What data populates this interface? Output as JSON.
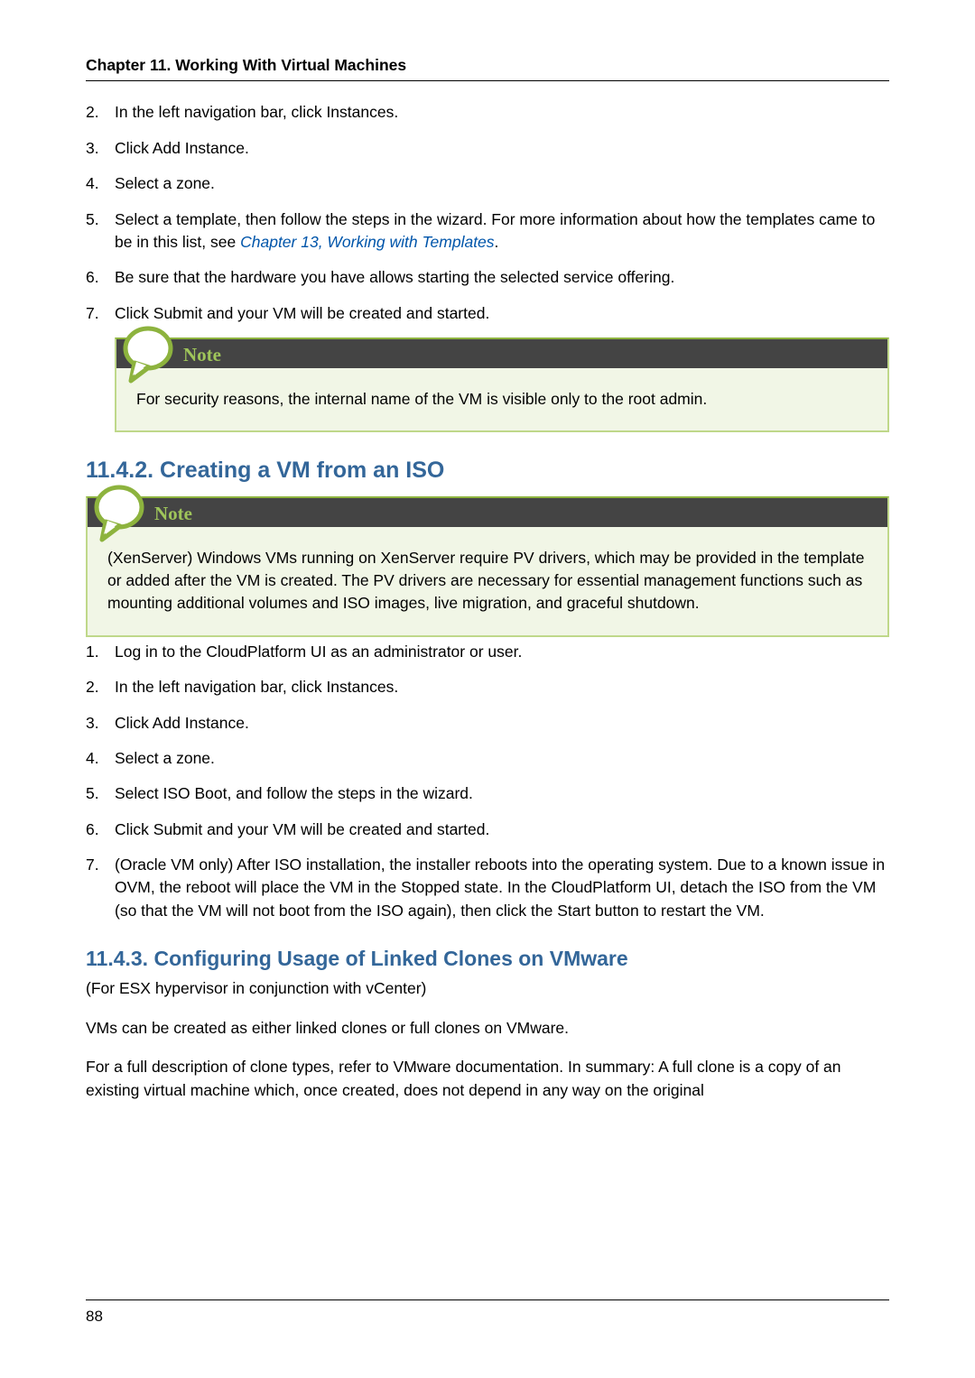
{
  "chapter_header": "Chapter 11. Working With Virtual Machines",
  "list1": {
    "n2": "2.",
    "t2": "In the left navigation bar, click Instances.",
    "n3": "3.",
    "t3": "Click Add Instance.",
    "n4": "4.",
    "t4": "Select a zone.",
    "n5": "5.",
    "t5a": "Select a template, then follow the steps in the wizard. For more information about how the templates came to be in this list, see ",
    "t5link": "Chapter 13, Working with Templates",
    "t5b": ".",
    "n6": "6.",
    "t6": "Be sure that the hardware you have allows starting the selected service offering.",
    "n7": "7.",
    "t7": "Click Submit and your VM will be created and started."
  },
  "note_label": "Note",
  "note1_body": "For security reasons, the internal name of the VM is visible only to the root admin.",
  "section1_title": "11.4.2. Creating a VM from an ISO",
  "note2_body": "(XenServer) Windows VMs running on XenServer require PV drivers, which may be provided in the template or added after the VM is created. The PV drivers are necessary for essential management functions such as mounting additional volumes and ISO images, live migration, and graceful shutdown.",
  "list2": {
    "n1": "1.",
    "t1": "Log in to the CloudPlatform UI as an administrator or user.",
    "n2": "2.",
    "t2": "In the left navigation bar, click Instances.",
    "n3": "3.",
    "t3": "Click Add Instance.",
    "n4": "4.",
    "t4": "Select a zone.",
    "n5": "5.",
    "t5": "Select ISO Boot, and follow the steps in the wizard.",
    "n6": "6.",
    "t6": "Click Submit and your VM will be created and started.",
    "n7": "7.",
    "t7": "(Oracle VM only) After ISO installation, the installer reboots into the operating system. Due to a known issue in OVM, the reboot will place the VM in the Stopped state. In the CloudPlatform UI, detach the ISO from the VM (so that the VM will not boot from the ISO again), then click the Start button to restart the VM."
  },
  "section2_title": "11.4.3. Configuring Usage of Linked Clones on VMware",
  "p1": "(For ESX hypervisor in conjunction with vCenter)",
  "p2": "VMs can be created as either linked clones or full clones on VMware.",
  "p3": "For a full description of clone types, refer to VMware documentation. In summary: A full clone is a copy of an existing virtual machine which, once created, does not depend in any way on the original",
  "page_number": "88"
}
